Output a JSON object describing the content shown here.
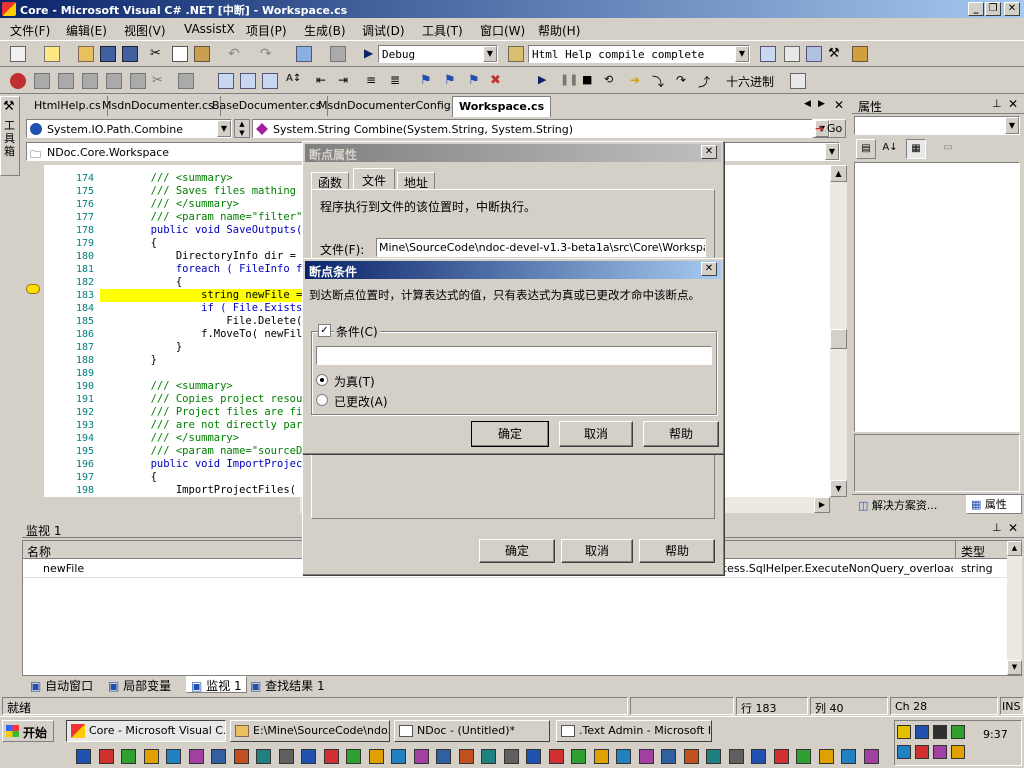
{
  "window": {
    "title": "Core - Microsoft Visual C# .NET [中断] - Workspace.cs"
  },
  "menu": [
    "文件(F)",
    "编辑(E)",
    "视图(V)",
    "VAssistX",
    "项目(P)",
    "生成(B)",
    "调试(D)",
    "工具(T)",
    "窗口(W)",
    "帮助(H)"
  ],
  "toolbar": {
    "config": "Debug",
    "status_combo": "Html Help compile complete",
    "hex_label": "十六进制"
  },
  "left_toolbox": {
    "label": "工具箱"
  },
  "editor": {
    "tabs": [
      "HtmlHelp.cs",
      "MsdnDocumenter.cs",
      "BaseDocumenter.cs",
      "MsdnDocumenterConfig.cs",
      "Workspace.cs"
    ],
    "active_tab": "Workspace.cs",
    "member_combo": "System.IO.Path.Combine",
    "signature_combo": "System.String Combine(System.String, System.String)",
    "go_label": "Go",
    "class_combo": "NDoc.Core.Workspace",
    "lines": [
      {
        "n": "174",
        "text": "        /// <summary>"
      },
      {
        "n": "175",
        "text": "        /// Saves files mathing the s"
      },
      {
        "n": "176",
        "text": "        /// </summary>"
      },
      {
        "n": "177",
        "text": "        /// <param name=\"filter\">File"
      },
      {
        "n": "178",
        "text": "        public void SaveOutputs( stri"
      },
      {
        "n": "179",
        "text": "        {"
      },
      {
        "n": "180",
        "text": "            DirectoryInfo dir = new D"
      },
      {
        "n": "181",
        "text": "            foreach ( FileInfo f in d"
      },
      {
        "n": "182",
        "text": "            {"
      },
      {
        "n": "183",
        "text": "                string newFile = Path"
      },
      {
        "n": "184",
        "text": "                if ( File.Exists( new"
      },
      {
        "n": "185",
        "text": "                    File.Delete( newF"
      },
      {
        "n": "186",
        "text": "                f.MoveTo( newFile );"
      },
      {
        "n": "187",
        "text": "            }"
      },
      {
        "n": "188",
        "text": "        }"
      },
      {
        "n": "189",
        "text": ""
      },
      {
        "n": "190",
        "text": "        /// <summary>"
      },
      {
        "n": "191",
        "text": "        /// Copies project resources"
      },
      {
        "n": "192",
        "text": "        /// Project files are files r"
      },
      {
        "n": "193",
        "text": "        /// are not directly part of"
      },
      {
        "n": "194",
        "text": "        /// </summary>"
      },
      {
        "n": "195",
        "text": "        /// <param name=\"sourceDirect"
      },
      {
        "n": "196",
        "text": "        public void ImportProjectFile"
      },
      {
        "n": "197",
        "text": "        {"
      },
      {
        "n": "198",
        "text": "            ImportProjectFiles( sourc"
      },
      {
        "n": "199",
        "text": "        }"
      }
    ]
  },
  "properties": {
    "title": "属性",
    "tab_solution": "解决方案资...",
    "tab_properties": "属性"
  },
  "watch": {
    "title": "监视 1",
    "col_name": "名称",
    "col_type": "类型",
    "row_name": "newFile",
    "row_value": "cess.SqlHelper.ExecuteNonQuery_overloads.htm",
    "row_type": "string",
    "tabs": [
      "自动窗口",
      "局部变量",
      "监视 1",
      "查找结果 1"
    ]
  },
  "statusbar": {
    "ready": "就绪",
    "line": "行 183",
    "col": "列 40",
    "ch": "Ch 28",
    "ins": "INS"
  },
  "bp_dialog": {
    "title": "断点属性",
    "tabs": [
      "函数",
      "文件",
      "地址"
    ],
    "description": "程序执行到文件的该位置时，中断执行。",
    "file_label": "文件(F):",
    "file_value": "Mine\\SourceCode\\ndoc-devel-v1.3-beta1a\\src\\Core\\Workspace.cs",
    "ok": "确定",
    "cancel": "取消",
    "help": "帮助"
  },
  "cond_dialog": {
    "title": "断点条件",
    "description": "到达断点位置时，计算表达式的值，只有表达式为真或已更改才命中该断点。",
    "condition_label": "条件(C)",
    "condition_value": "",
    "radio_true": "为真(T)",
    "radio_changed": "已更改(A)",
    "ok": "确定",
    "cancel": "取消",
    "help": "帮助"
  },
  "taskbar": {
    "start": "开始",
    "tasks": [
      "Core - Microsoft Visual C...",
      "E:\\Mine\\SourceCode\\ndo...",
      "NDoc - (Untitled)*",
      ".Text Admin - Microsoft I..."
    ],
    "clock": "9:37"
  },
  "colors": {
    "title_active": "#0a246a",
    "title_gradient_end": "#a6caf0",
    "breakpoint_highlight": "#ffff00",
    "comment": "#008000",
    "keyword": "#0000ff"
  }
}
